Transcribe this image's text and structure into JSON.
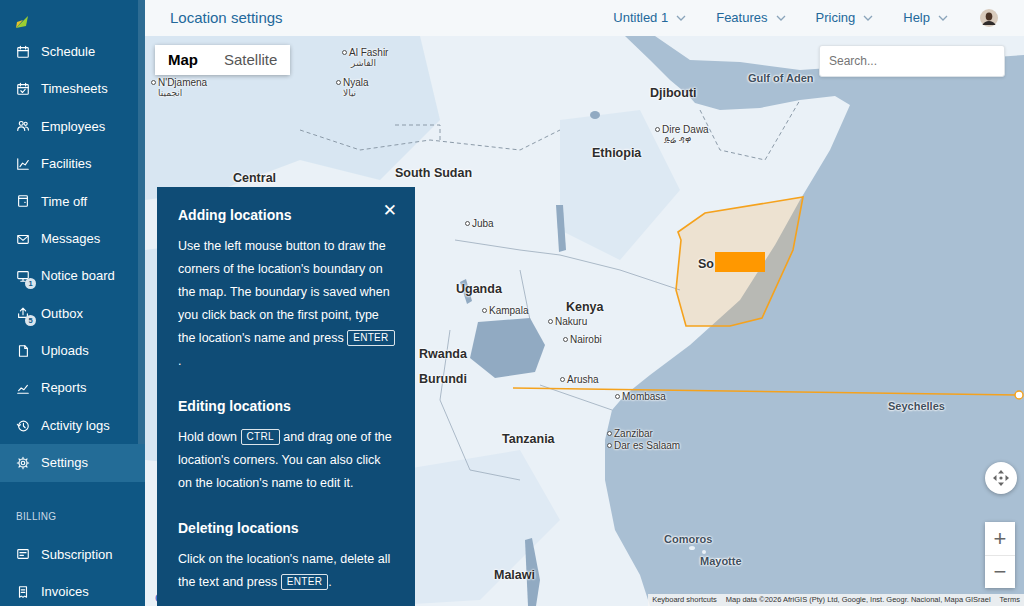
{
  "app": {
    "title": "Location settings"
  },
  "sidebar": {
    "items": [
      {
        "label": "Schedule",
        "selected": false
      },
      {
        "label": "Timesheets",
        "selected": false
      },
      {
        "label": "Employees",
        "selected": false
      },
      {
        "label": "Facilities",
        "selected": false
      },
      {
        "label": "Time off",
        "selected": false
      },
      {
        "label": "Messages",
        "selected": false
      },
      {
        "label": "Notice board",
        "selected": false,
        "badge": "1"
      },
      {
        "label": "Outbox",
        "selected": false,
        "badge": "5"
      },
      {
        "label": "Uploads",
        "selected": false
      },
      {
        "label": "Reports",
        "selected": false
      },
      {
        "label": "Activity logs",
        "selected": false
      },
      {
        "label": "Settings",
        "selected": true
      }
    ],
    "billing": {
      "heading": "BILLING",
      "items": [
        {
          "label": "Subscription",
          "selected": false
        },
        {
          "label": "Invoices",
          "selected": false
        }
      ]
    }
  },
  "header": {
    "menus": [
      {
        "label": "Untitled 1"
      },
      {
        "label": "Features"
      },
      {
        "label": "Pricing"
      },
      {
        "label": "Help"
      }
    ]
  },
  "map": {
    "types": [
      {
        "label": "Map",
        "selected": true
      },
      {
        "label": "Satellite",
        "selected": false
      }
    ],
    "search": {
      "placeholder": "Search..."
    },
    "labels": [
      {
        "text": "Al Fashir",
        "kind": "city"
      },
      {
        "text": "الفاشر",
        "kind": "native"
      },
      {
        "text": "Nyala",
        "kind": "city"
      },
      {
        "text": "نيالا",
        "kind": "native"
      },
      {
        "text": "N'Djamena",
        "kind": "city"
      },
      {
        "text": "انجمينا",
        "kind": "native"
      },
      {
        "text": "Djibouti",
        "kind": "country"
      },
      {
        "text": "Gulf of Aden",
        "kind": "water"
      },
      {
        "text": "Dire Dawa",
        "kind": "city"
      },
      {
        "text": "ድሬ ዳዋ",
        "kind": "native"
      },
      {
        "text": "Ethiopia",
        "kind": "country"
      },
      {
        "text": "South Sudan",
        "kind": "country"
      },
      {
        "text": "Central",
        "kind": "country"
      },
      {
        "text": "Juba",
        "kind": "city"
      },
      {
        "text": "Uganda",
        "kind": "country"
      },
      {
        "text": "Kampala",
        "kind": "city"
      },
      {
        "text": "Kenya",
        "kind": "country"
      },
      {
        "text": "Nakuru",
        "kind": "city"
      },
      {
        "text": "Nairobi",
        "kind": "city"
      },
      {
        "text": "Rwanda",
        "kind": "country"
      },
      {
        "text": "Burundi",
        "kind": "country"
      },
      {
        "text": "Arusha",
        "kind": "city"
      },
      {
        "text": "Mombasa",
        "kind": "city"
      },
      {
        "text": "Seychelles",
        "kind": "water"
      },
      {
        "text": "Tanzania",
        "kind": "country"
      },
      {
        "text": "Zanzibar",
        "kind": "city"
      },
      {
        "text": "Dar es Salaam",
        "kind": "city"
      },
      {
        "text": "Comoros",
        "kind": "water"
      },
      {
        "text": "Mayotte",
        "kind": "water"
      },
      {
        "text": "Malawi",
        "kind": "country"
      },
      {
        "text": "So",
        "kind": "country"
      }
    ],
    "zoom": {
      "in": "+",
      "out": "−"
    },
    "google": "Google",
    "attribution": [
      "Keyboard shortcuts",
      "Map data ©2026 AfriGIS (Pty) Ltd, Google, Inst. Geogr. Nacional, Mapa GISrael",
      "Terms"
    ]
  },
  "help": {
    "close": "✕",
    "sections": [
      {
        "title": "Adding locations",
        "body": [
          {
            "kind": "text",
            "text": "Use the left mouse button to draw the corners of the location's boundary on the map. The boundary is saved when you click back on the first point, type the location's name and press "
          },
          {
            "kind": "key",
            "text": "ENTER"
          },
          {
            "kind": "text",
            "text": "."
          }
        ]
      },
      {
        "title": "Editing locations",
        "body": [
          {
            "kind": "text",
            "text": "Hold down "
          },
          {
            "kind": "key",
            "text": "CTRL"
          },
          {
            "kind": "text",
            "text": " and drag one of the location's corners. You can also click on the location's name to edit it."
          }
        ]
      },
      {
        "title": "Deleting locations",
        "body": [
          {
            "kind": "text",
            "text": "Click on the location's name, delete all the text and press "
          },
          {
            "kind": "key",
            "text": "ENTER"
          },
          {
            "kind": "text",
            "text": "."
          }
        ]
      }
    ]
  }
}
